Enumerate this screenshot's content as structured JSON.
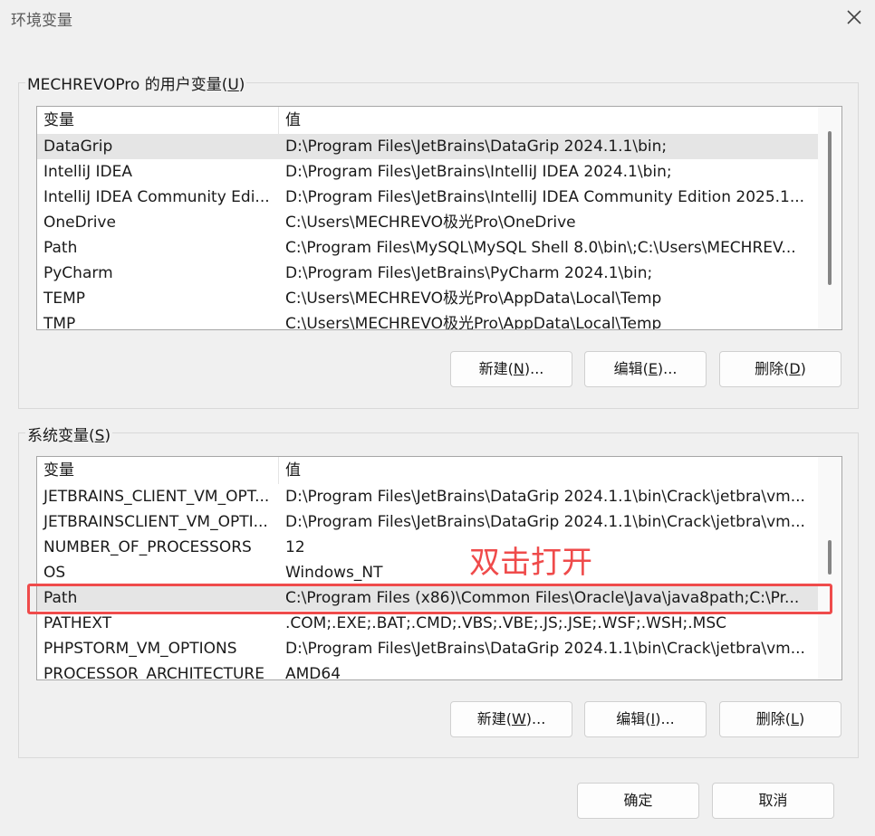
{
  "window": {
    "title": "环境变量",
    "close_icon": "close-icon"
  },
  "user_vars": {
    "group_label_prefix": "MECHREVOPro 的用户变量(",
    "group_label_key": "U",
    "group_label_suffix": ")",
    "columns": [
      "变量",
      "值"
    ],
    "rows": [
      {
        "name": "DataGrip",
        "value": "D:\\Program Files\\JetBrains\\DataGrip 2024.1.1\\bin;"
      },
      {
        "name": "IntelliJ IDEA",
        "value": "D:\\Program Files\\JetBrains\\IntelliJ IDEA 2024.1\\bin;"
      },
      {
        "name": "IntelliJ IDEA Community Edi...",
        "value": "D:\\Program Files\\JetBrains\\IntelliJ IDEA Community Edition 2025.1..."
      },
      {
        "name": "OneDrive",
        "value": "C:\\Users\\MECHREVO极光Pro\\OneDrive"
      },
      {
        "name": "Path",
        "value": "C:\\Program Files\\MySQL\\MySQL Shell 8.0\\bin\\;C:\\Users\\MECHREV..."
      },
      {
        "name": "PyCharm",
        "value": "D:\\Program Files\\JetBrains\\PyCharm 2024.1\\bin;"
      },
      {
        "name": "TEMP",
        "value": "C:\\Users\\MECHREVO极光Pro\\AppData\\Local\\Temp"
      },
      {
        "name": "TMP",
        "value": "C:\\Users\\MECHREVO极光Pro\\AppData\\Local\\Temp"
      }
    ],
    "buttons": {
      "new": {
        "prefix": "新建(",
        "key": "N",
        "suffix": ")..."
      },
      "edit": {
        "prefix": "编辑(",
        "key": "E",
        "suffix": ")..."
      },
      "delete": {
        "prefix": "删除(",
        "key": "D",
        "suffix": ")"
      }
    }
  },
  "system_vars": {
    "group_label_prefix": "系统变量(",
    "group_label_key": "S",
    "group_label_suffix": ")",
    "columns": [
      "变量",
      "值"
    ],
    "rows": [
      {
        "name": "JETBRAINS_CLIENT_VM_OPT...",
        "value": "D:\\Program Files\\JetBrains\\DataGrip 2024.1.1\\bin\\Crack\\jetbra\\vm..."
      },
      {
        "name": "JETBRAINSCLIENT_VM_OPTI...",
        "value": "D:\\Program Files\\JetBrains\\DataGrip 2024.1.1\\bin\\Crack\\jetbra\\vm..."
      },
      {
        "name": "NUMBER_OF_PROCESSORS",
        "value": "12"
      },
      {
        "name": "OS",
        "value": "Windows_NT"
      },
      {
        "name": "Path",
        "value": "C:\\Program Files (x86)\\Common Files\\Oracle\\Java\\java8path;C:\\Pr..."
      },
      {
        "name": "PATHEXT",
        "value": ".COM;.EXE;.BAT;.CMD;.VBS;.VBE;.JS;.JSE;.WSF;.WSH;.MSC"
      },
      {
        "name": "PHPSTORM_VM_OPTIONS",
        "value": "D:\\Program Files\\JetBrains\\DataGrip 2024.1.1\\bin\\Crack\\jetbra\\vm..."
      },
      {
        "name": "PROCESSOR_ARCHITECTURE",
        "value": "AMD64"
      }
    ],
    "selected_row": 4,
    "buttons": {
      "new": {
        "prefix": "新建(",
        "key": "W",
        "suffix": ")..."
      },
      "edit": {
        "prefix": "编辑(",
        "key": "I",
        "suffix": ")..."
      },
      "delete": {
        "prefix": "删除(",
        "key": "L",
        "suffix": ")"
      }
    }
  },
  "annotation": {
    "text": "双击打开",
    "color": "#ef4b4b"
  },
  "footer": {
    "ok": "确定",
    "cancel": "取消"
  }
}
